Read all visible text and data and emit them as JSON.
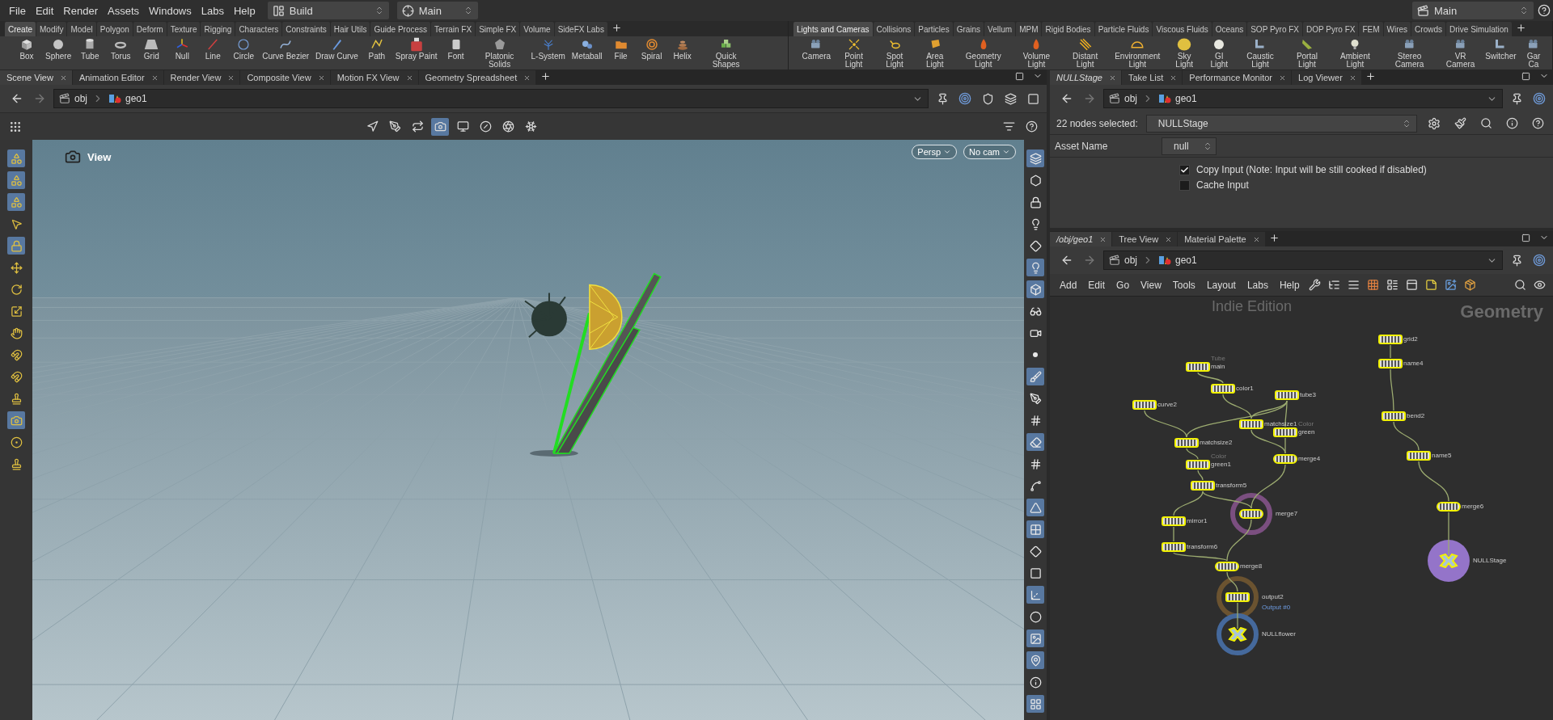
{
  "menu": [
    "File",
    "Edit",
    "Render",
    "Assets",
    "Windows",
    "Labs",
    "Help"
  ],
  "desktop": {
    "label": "Build"
  },
  "context": {
    "label": "Main"
  },
  "right_context": {
    "label": "Main"
  },
  "shelf_left": {
    "tabs": [
      {
        "label": "Create",
        "selected": true
      },
      {
        "label": "Modify",
        "selected": false
      },
      {
        "label": "Model",
        "selected": false
      },
      {
        "label": "Polygon",
        "selected": false
      },
      {
        "label": "Deform",
        "selected": false
      },
      {
        "label": "Texture",
        "selected": false
      },
      {
        "label": "Rigging",
        "selected": false
      },
      {
        "label": "Characters",
        "selected": false
      },
      {
        "label": "Constraints",
        "selected": false
      },
      {
        "label": "Hair Utils",
        "selected": false
      },
      {
        "label": "Guide Process",
        "selected": false
      },
      {
        "label": "Terrain FX",
        "selected": false
      },
      {
        "label": "Simple FX",
        "selected": false
      },
      {
        "label": "Volume",
        "selected": false
      },
      {
        "label": "SideFX Labs",
        "selected": false
      }
    ],
    "tools": [
      "Box",
      "Sphere",
      "Tube",
      "Torus",
      "Grid",
      "Null",
      "Line",
      "Circle",
      "Curve Bezier",
      "Draw Curve",
      "Path",
      "Spray Paint",
      "Font",
      "Platonic Solids",
      "L-System",
      "Metaball",
      "File",
      "Spiral",
      "Helix",
      "Quick Shapes"
    ]
  },
  "shelf_right": {
    "tabs": [
      {
        "label": "Lights and Cameras",
        "selected": true
      },
      {
        "label": "Collisions",
        "selected": false
      },
      {
        "label": "Particles",
        "selected": false
      },
      {
        "label": "Grains",
        "selected": false
      },
      {
        "label": "Vellum",
        "selected": false
      },
      {
        "label": "MPM",
        "selected": false
      },
      {
        "label": "Rigid Bodies",
        "selected": false
      },
      {
        "label": "Particle Fluids",
        "selected": false
      },
      {
        "label": "Viscous Fluids",
        "selected": false
      },
      {
        "label": "Oceans",
        "selected": false
      },
      {
        "label": "SOP Pyro FX",
        "selected": false
      },
      {
        "label": "DOP Pyro FX",
        "selected": false
      },
      {
        "label": "FEM",
        "selected": false
      },
      {
        "label": "Wires",
        "selected": false
      },
      {
        "label": "Crowds",
        "selected": false
      },
      {
        "label": "Drive Simulation",
        "selected": false
      }
    ],
    "tools": [
      "Camera",
      "Point Light",
      "Spot Light",
      "Area Light",
      "Geometry Light",
      "Volume Light",
      "Distant Light",
      "Environment Light",
      "Sky Light",
      "GI Light",
      "Caustic Light",
      "Portal Light",
      "Ambient Light",
      "Stereo Camera",
      "VR Camera",
      "Switcher",
      "Gar Ca"
    ]
  },
  "viewer_pane": {
    "tabs": [
      {
        "label": "Scene View",
        "selected": true
      },
      {
        "label": "Animation Editor",
        "selected": false
      },
      {
        "label": "Render View",
        "selected": false
      },
      {
        "label": "Composite View",
        "selected": false
      },
      {
        "label": "Motion FX View",
        "selected": false
      },
      {
        "label": "Geometry Spreadsheet",
        "selected": false
      }
    ],
    "path": [
      "obj",
      "geo1"
    ],
    "top_tools": [
      {
        "on": false
      },
      {
        "on": false
      },
      {
        "on": false
      },
      {
        "on": true
      },
      {
        "on": false
      },
      {
        "on": false
      },
      {
        "on": false
      },
      {
        "on": false
      }
    ],
    "left_tools": [
      {
        "on": true
      },
      {
        "on": true
      },
      {
        "on": true
      },
      {
        "on": false
      },
      {
        "on": true
      },
      {
        "on": false
      },
      {
        "on": false
      },
      {
        "on": false
      },
      {
        "on": false
      },
      {
        "on": false
      },
      {
        "on": false
      },
      {
        "on": false
      },
      {
        "on": true
      },
      {
        "on": false
      },
      {
        "on": false
      }
    ],
    "right_tools": [
      {
        "on": true
      },
      {
        "on": false
      },
      {
        "on": false
      },
      {
        "on": false
      },
      {
        "on": false
      },
      {
        "on": true
      },
      {
        "on": true
      },
      {
        "on": false
      },
      {
        "on": false
      },
      {
        "on": false
      },
      {
        "on": true
      },
      {
        "on": false
      },
      {
        "on": false
      },
      {
        "on": true
      },
      {
        "on": false
      },
      {
        "on": false
      },
      {
        "on": true
      },
      {
        "on": true
      },
      {
        "on": false
      },
      {
        "on": false
      },
      {
        "on": true
      },
      {
        "on": false
      },
      {
        "on": true
      },
      {
        "on": true
      },
      {
        "on": false
      },
      {
        "on": true
      }
    ],
    "view_label": "View",
    "projection": "Persp",
    "camera": "No cam"
  },
  "params_pane": {
    "tabs": [
      {
        "label": "NULLStage",
        "selected": true
      },
      {
        "label": "Take List",
        "selected": false
      },
      {
        "label": "Performance Monitor",
        "selected": false
      },
      {
        "label": "Log Viewer",
        "selected": false
      }
    ],
    "path": [
      "obj",
      "geo1"
    ],
    "selection_label": "22 nodes selected:",
    "node_name": "NULLStage",
    "asset_label": "Asset Name",
    "asset_value": "null",
    "checkboxes": [
      {
        "label": "Copy Input (Note: Input will be still cooked if disabled)",
        "checked": true
      },
      {
        "label": "Cache Input",
        "checked": false
      }
    ]
  },
  "network_pane": {
    "tabs": [
      {
        "label": "/obj/geo1",
        "selected": true
      },
      {
        "label": "Tree View",
        "selected": false
      },
      {
        "label": "Material Palette",
        "selected": false
      }
    ],
    "path": [
      "obj",
      "geo1"
    ],
    "menu": [
      "Add",
      "Edit",
      "Go",
      "View",
      "Tools",
      "Layout",
      "Labs",
      "Help"
    ],
    "watermark": "Indie Edition",
    "context_label": "Geometry",
    "nodes": [
      {
        "name": "main",
        "kind": "sop",
        "selected": true,
        "note": "Tube",
        "note_below": false
      },
      {
        "name": "color1",
        "kind": "sop",
        "selected": true
      },
      {
        "name": "tube3",
        "kind": "sop",
        "selected": true
      },
      {
        "name": "curve2",
        "kind": "sop",
        "selected": true
      },
      {
        "name": "matchsize1",
        "kind": "sop",
        "selected": true
      },
      {
        "name": "green",
        "kind": "sop",
        "selected": true,
        "note": "Color",
        "note_below": false
      },
      {
        "name": "matchsize2",
        "kind": "sop",
        "selected": true
      },
      {
        "name": "merge4",
        "kind": "merge",
        "selected": true
      },
      {
        "name": "green1",
        "kind": "sop",
        "selected": true,
        "note": "Color",
        "note_below": false
      },
      {
        "name": "transform5",
        "kind": "sop",
        "selected": true
      },
      {
        "name": "merge7",
        "kind": "merge",
        "selected": true,
        "ring_filled": false,
        "color": "#7b4f80"
      },
      {
        "name": "mirror1",
        "kind": "sop",
        "selected": true
      },
      {
        "name": "transform6",
        "kind": "sop",
        "selected": true
      },
      {
        "name": "merge8",
        "kind": "merge",
        "selected": true
      },
      {
        "name": "output2",
        "kind": "sop",
        "selected": true,
        "ring_filled": false,
        "color": "#6b5330",
        "note": "Output #0",
        "note_below": true
      },
      {
        "name": "NULLflower",
        "kind": "null",
        "selected": true,
        "ring_filled": false,
        "color": "#45699c"
      },
      {
        "name": "grid2",
        "kind": "sop",
        "selected": true
      },
      {
        "name": "name4",
        "kind": "sop",
        "selected": true
      },
      {
        "name": "bend2",
        "kind": "sop",
        "selected": true
      },
      {
        "name": "name5",
        "kind": "sop",
        "selected": true
      },
      {
        "name": "merge6",
        "kind": "merge",
        "selected": true
      },
      {
        "name": "NULLStage",
        "kind": "null",
        "selected": true,
        "ring_filled": true,
        "color": "#9474c9"
      }
    ]
  }
}
